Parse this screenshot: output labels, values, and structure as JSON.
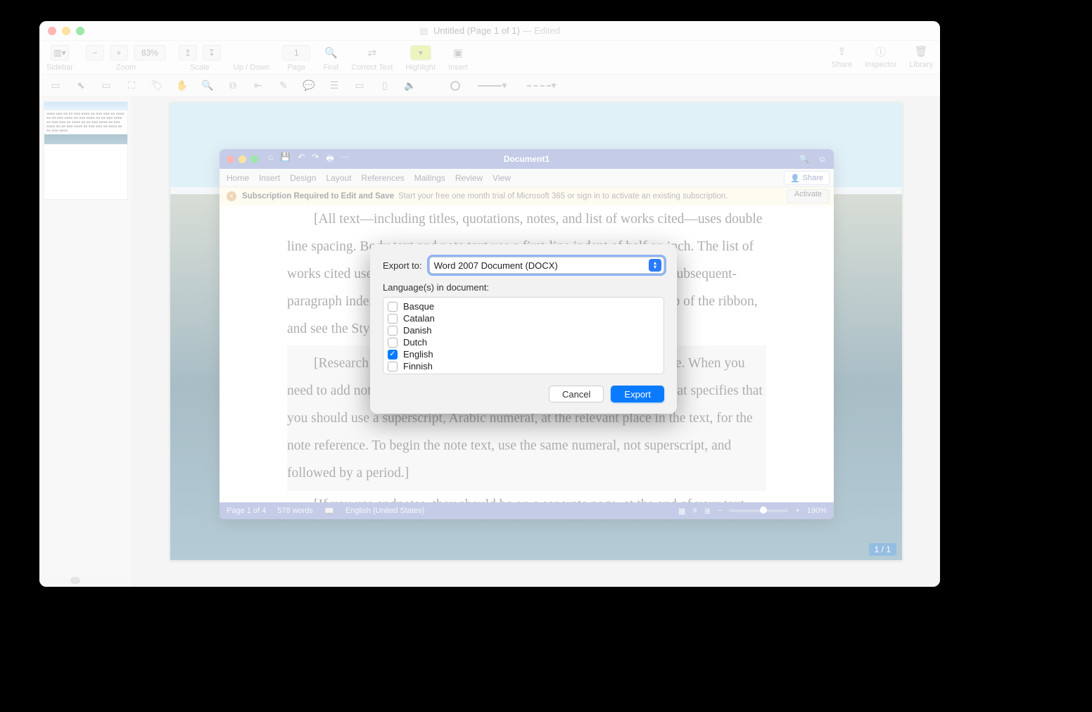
{
  "app": {
    "title_main": "Untitled (Page 1 of 1)",
    "title_suffix": " — Edited"
  },
  "toolbar": {
    "sidebar": "Sidebar",
    "zoom": "Zoom",
    "zoom_pct": "83%",
    "scale": "Scale",
    "updown": "Up / Down",
    "page": "Page",
    "page_num": "1",
    "find": "Find",
    "correct": "Correct Text",
    "highlight": "Highlight",
    "insert": "Insert",
    "share": "Share",
    "inspector": "Inspector",
    "library": "Library"
  },
  "page_counter": "1 / 1",
  "word": {
    "title": "Document1",
    "tabs": [
      "Home",
      "Insert",
      "Design",
      "Layout",
      "References",
      "Mailings",
      "Review",
      "View"
    ],
    "share": "Share",
    "banner_bold": "Subscription Required to Edit and Save",
    "banner_text": "Start your free one month trial of Microsoft 365 or sign in to activate an existing subscription.",
    "activate": "Activate",
    "para1": "[All text—including titles, quotations, notes, and list of works cited—uses double line spacing. Body text and note text use a first-line indent of half an inch. The list of works cited uses a half-inch hanging indent with no other first-line or subsequent-paragraph indent. To access all of these text formats, visit the Home tab of the ribbon, and see the Styles gallery.]",
    "para2": "[Research papers that use MLA format do not include a cover page. When you need to add notes, you can use either endnotes or footnotes. MLA format specifies that you should use a superscript, Arabic numeral, at the relevant place in the text, for the note reference. To begin the note text, use the same numeral, not superscript, and followed by a period.]",
    "para3": "[If you use endnotes, they should be on a separate page, at the end of your text and preceding the list of works cited. If you use footnotes, consult your professor for preferred format.]",
    "status_page": "Page 1 of 4",
    "status_words": "578 words",
    "status_lang": "English (United States)",
    "status_zoom": "190%"
  },
  "dialog": {
    "export_label": "Export to:",
    "format": "Word 2007 Document (DOCX)",
    "lang_label": "Language(s) in document:",
    "langs": [
      {
        "name": "Basque",
        "checked": false
      },
      {
        "name": "Catalan",
        "checked": false
      },
      {
        "name": "Danish",
        "checked": false
      },
      {
        "name": "Dutch",
        "checked": false
      },
      {
        "name": "English",
        "checked": true
      },
      {
        "name": "Finnish",
        "checked": false
      }
    ],
    "cancel": "Cancel",
    "export": "Export"
  }
}
